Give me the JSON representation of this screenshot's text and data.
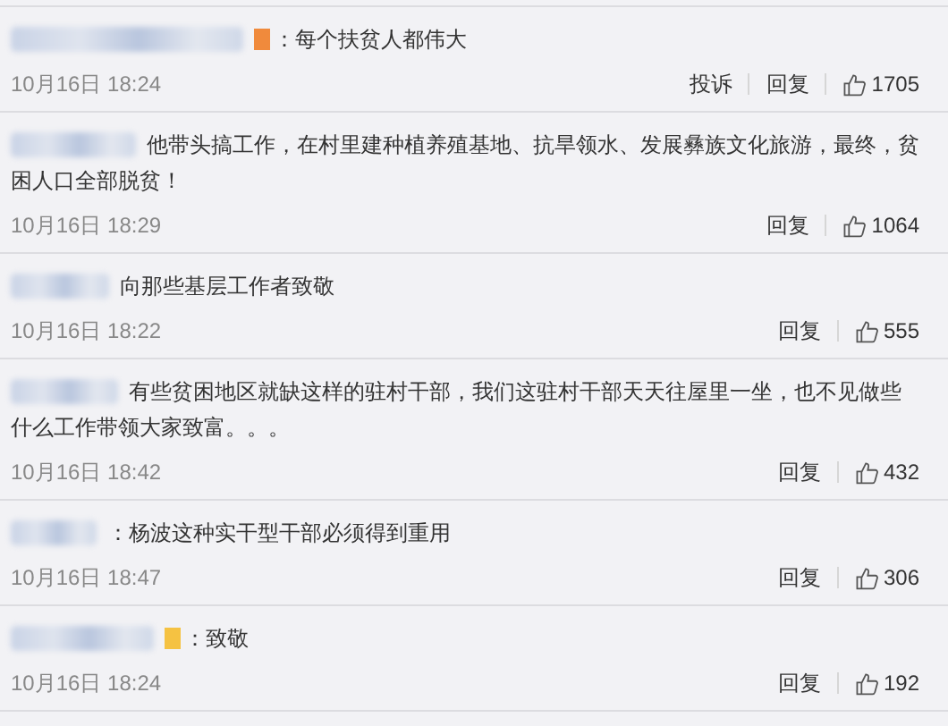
{
  "comments": [
    {
      "badge": {
        "color": "#f08a3c"
      },
      "lines": [
        "：每个扶贫人都伟大"
      ],
      "time": "10月16日 18:24",
      "actions": [
        "投诉",
        "回复"
      ],
      "likes": "1705"
    },
    {
      "lines": [
        "他带头搞工作，在村里建种植养殖基地、抗旱领水、发展彝族文化旅游，最终，贫",
        "困人口全部脱贫！"
      ],
      "time": "10月16日 18:29",
      "actions": [
        "回复"
      ],
      "likes": "1064"
    },
    {
      "lines": [
        "向那些基层工作者致敬"
      ],
      "time": "10月16日 18:22",
      "actions": [
        "回复"
      ],
      "likes": "555"
    },
    {
      "lines": [
        "有些贫困地区就缺这样的驻村干部，我们这驻村干部天天往屋里一坐，也不见做些",
        "什么工作带领大家致富。。。"
      ],
      "time": "10月16日 18:42",
      "actions": [
        "回复"
      ],
      "likes": "432"
    },
    {
      "lines": [
        "：杨波这种实干型干部必须得到重用"
      ],
      "time": "10月16日 18:47",
      "actions": [
        "回复"
      ],
      "likes": "306"
    },
    {
      "badge": {
        "color": "#f5c242"
      },
      "lines": [
        "：致敬"
      ],
      "time": "10月16日 18:24",
      "actions": [
        "回复"
      ],
      "likes": "192"
    }
  ]
}
